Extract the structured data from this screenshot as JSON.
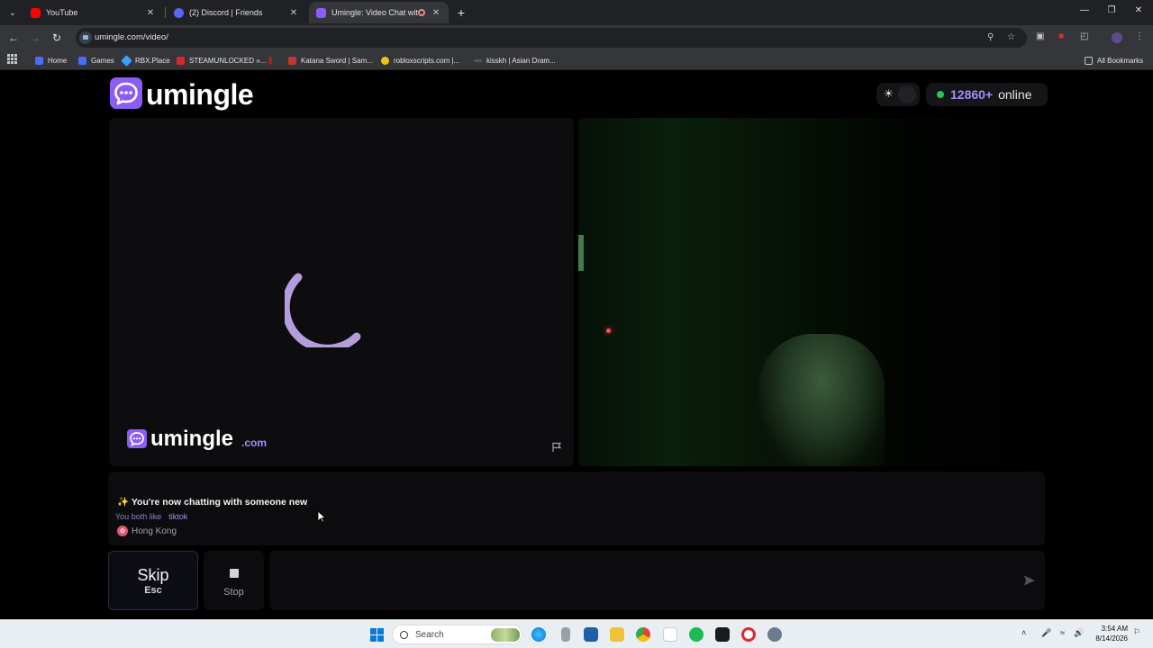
{
  "browser": {
    "tabs": [
      {
        "title": "YouTube",
        "color": "#ff0000"
      },
      {
        "title": "(2) Discord | Friends",
        "color": "#5865f2"
      },
      {
        "title": "Umingle: Video Chat with S",
        "color": "#8b5cf6"
      }
    ],
    "url": "umingle.com/video/",
    "bookmarks": [
      {
        "label": "Home",
        "color": "#4b6bfb"
      },
      {
        "label": "Games",
        "color": "#4b6bfb"
      },
      {
        "label": "RBX.Place",
        "color": "#3aa0ff"
      },
      {
        "label": "STEAMUNLOCKED »...",
        "color": "#d8262e"
      },
      {
        "label": "Katana Sword | Sam...",
        "color": "#c0392b"
      },
      {
        "label": "robloxscripts.com |...",
        "color": "#f1c40f"
      },
      {
        "label": "kisskh | Asian Dram...",
        "color": "#555555"
      }
    ],
    "all_bookmarks": "All Bookmarks"
  },
  "header": {
    "logo_text": "umingle",
    "online_count": "12860+",
    "online_label": "online"
  },
  "video": {
    "watermark_name": "umingle",
    "watermark_domain": ".com"
  },
  "chat": {
    "system_message": "You're now chatting with someone new",
    "likes_label": "You both like",
    "shared_interest": "tiktok",
    "location": "Hong Kong"
  },
  "controls": {
    "skip_label": "Skip",
    "skip_key": "Esc",
    "stop_label": "Stop",
    "message_placeholder": ""
  },
  "taskbar": {
    "search_label": "Search",
    "time": "3:54 AM",
    "date": "8/14/2026"
  },
  "colors": {
    "accent": "#8b5cf6",
    "accent_light": "#a78bfa",
    "online_dot": "#22c55e"
  }
}
